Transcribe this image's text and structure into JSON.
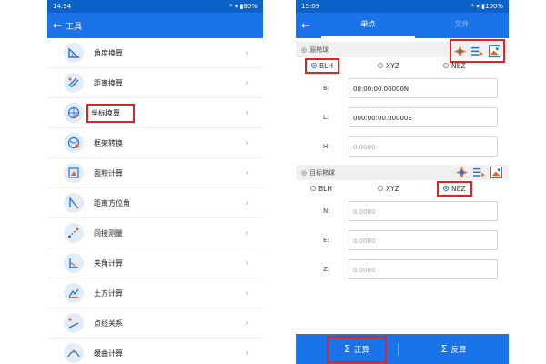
{
  "left": {
    "status": {
      "time": "14:34",
      "right": "* ▾ ▮80%"
    },
    "appbar": {
      "back": "←",
      "title": "工具"
    },
    "items": [
      {
        "label": "角度换算",
        "icon": "angle-convert-icon"
      },
      {
        "label": "距离换算",
        "icon": "distance-convert-icon"
      },
      {
        "label": "坐标换算",
        "icon": "coordinate-convert-icon",
        "highlighted": true
      },
      {
        "label": "框架转换",
        "icon": "frame-transform-icon"
      },
      {
        "label": "面积计算",
        "icon": "area-calc-icon"
      },
      {
        "label": "距离方位角",
        "icon": "distance-azimuth-icon"
      },
      {
        "label": "间接测量",
        "icon": "indirect-measure-icon"
      },
      {
        "label": "夹角计算",
        "icon": "included-angle-icon"
      },
      {
        "label": "土方计算",
        "icon": "earthwork-icon"
      },
      {
        "label": "点线关系",
        "icon": "point-line-icon"
      },
      {
        "label": "缓曲计算",
        "icon": "curve-calc-icon"
      }
    ],
    "chevron": "›"
  },
  "right": {
    "status": {
      "time": "15:09",
      "right": "* ▾ ▮100%"
    },
    "tabs": {
      "back": "←",
      "active": "单点",
      "inactive": "文件"
    },
    "source": {
      "title": "源椭球",
      "radios": [
        "BLH",
        "XYZ",
        "NEZ"
      ],
      "selected": "BLH",
      "fields": [
        {
          "label": "B:",
          "value": "00:00:00.00000N",
          "placeholder": false
        },
        {
          "label": "L:",
          "value": "000:00:00.00000E",
          "placeholder": false
        },
        {
          "label": "H:",
          "value": "0.0000",
          "placeholder": true
        }
      ]
    },
    "target": {
      "title": "目标椭球",
      "radios": [
        "BLH",
        "XYZ",
        "NEZ"
      ],
      "selected": "NEZ",
      "fields": [
        {
          "label": "N:",
          "value": "0.0000",
          "placeholder": true
        },
        {
          "label": "E:",
          "value": "0.0000",
          "placeholder": true
        },
        {
          "label": "Z:",
          "value": "0.0000",
          "placeholder": true
        }
      ]
    },
    "bottom": {
      "forward": "正算",
      "inverse": "反算"
    }
  },
  "colors": {
    "primary": "#1a73e8",
    "highlight": "#d92626"
  }
}
